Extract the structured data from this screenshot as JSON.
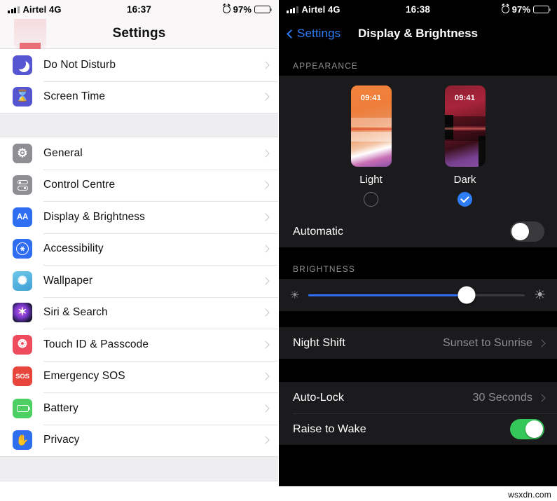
{
  "left": {
    "status": {
      "carrier": "Airtel 4G",
      "network": "4G",
      "time": "16:37",
      "battery_pct": "97%"
    },
    "nav_title": "Settings",
    "groups": [
      {
        "items": [
          {
            "label": "Do Not Disturb",
            "icon": "moon-icon",
            "icon_color": "#5655d2",
            "glyph": ""
          },
          {
            "label": "Screen Time",
            "icon": "hourglass-icon",
            "icon_color": "#5655d2",
            "glyph": "⌛"
          }
        ]
      },
      {
        "items": [
          {
            "label": "General",
            "icon": "gear-icon",
            "icon_color": "#8e8e93",
            "glyph": "⚙"
          },
          {
            "label": "Control Centre",
            "icon": "control-centre-icon",
            "icon_color": "#8e8e93",
            "glyph": ""
          },
          {
            "label": "Display & Brightness",
            "icon": "aa-text-icon",
            "icon_color": "#2f6df3",
            "glyph": "AA"
          },
          {
            "label": "Accessibility",
            "icon": "accessibility-icon",
            "icon_color": "#2f6df3",
            "glyph": "✦"
          },
          {
            "label": "Wallpaper",
            "icon": "wallpaper-flower-icon",
            "icon_color": "#4eb3de",
            "glyph": "✺"
          },
          {
            "label": "Siri & Search",
            "icon": "siri-icon",
            "icon_color": "#1a1a2e",
            "glyph": "✶"
          },
          {
            "label": "Touch ID & Passcode",
            "icon": "fingerprint-icon",
            "icon_color": "#ef4b5c",
            "glyph": "❂"
          },
          {
            "label": "Emergency SOS",
            "icon": "sos-icon",
            "icon_color": "#e8453c",
            "glyph": "SOS"
          },
          {
            "label": "Battery",
            "icon": "battery-icon",
            "icon_color": "#4cd063",
            "glyph": ""
          },
          {
            "label": "Privacy",
            "icon": "hand-icon",
            "icon_color": "#2f6df3",
            "glyph": "✋"
          }
        ]
      }
    ]
  },
  "right": {
    "status": {
      "carrier": "Airtel 4G",
      "time": "16:38",
      "battery_pct": "97%"
    },
    "back_label": "Settings",
    "nav_title": "Display & Brightness",
    "appearance": {
      "section_label": "APPEARANCE",
      "options": [
        {
          "name": "Light",
          "time": "09:41",
          "selected": false
        },
        {
          "name": "Dark",
          "time": "09:41",
          "selected": true
        }
      ],
      "automatic": {
        "label": "Automatic",
        "on": false
      }
    },
    "brightness": {
      "section_label": "BRIGHTNESS",
      "value_pct": 73,
      "low_icon": "sun-small-icon",
      "high_icon": "sun-large-icon"
    },
    "rows": [
      {
        "label": "Night Shift",
        "value": "Sunset to Sunrise",
        "type": "disclosure"
      },
      {
        "label": "Auto-Lock",
        "value": "30 Seconds",
        "type": "disclosure"
      },
      {
        "label": "Raise to Wake",
        "value": "",
        "type": "toggle",
        "on": true
      }
    ]
  },
  "watermark": "wsxdn.com",
  "colors": {
    "accent_blue": "#2f7df6",
    "toggle_green": "#35c759",
    "dark_row": "#1b1b1d"
  }
}
